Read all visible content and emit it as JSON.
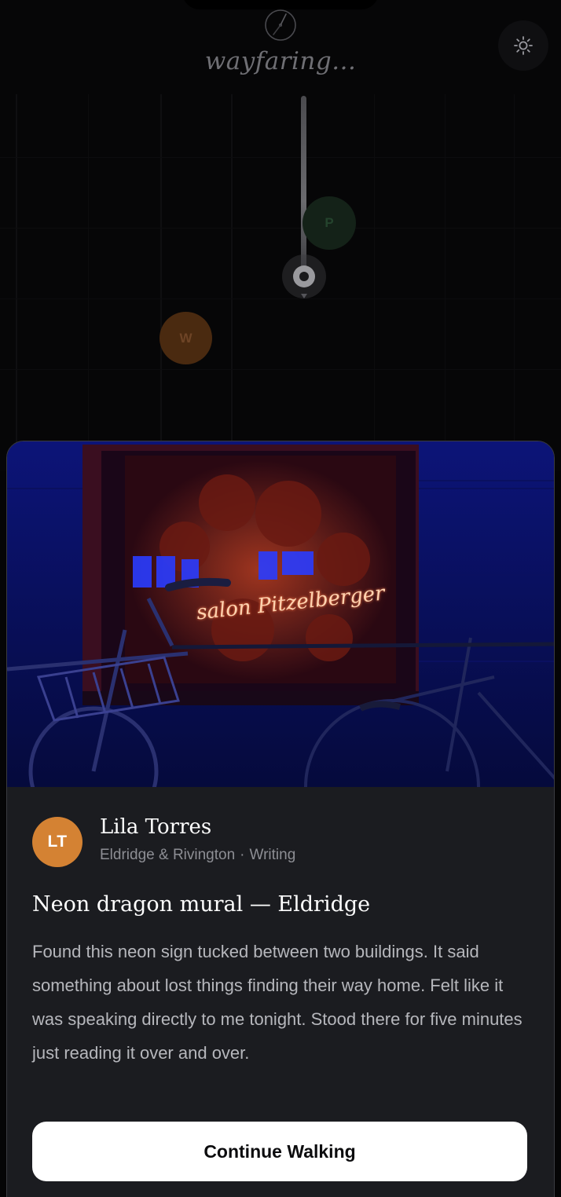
{
  "header": {
    "brand": "wayfaring...",
    "compass_icon": "compass-icon",
    "theme_icon": "sun-icon"
  },
  "map": {
    "markers": [
      {
        "initial": "P",
        "color": "#142218"
      },
      {
        "initial": "W",
        "color": "#4a2a10"
      }
    ],
    "user_location_icon": "location-dot-icon"
  },
  "post": {
    "photo_icon": "neon-sign-photo",
    "neon_text": "salon Pitzelberger",
    "avatar_initials": "LT",
    "author": "Lila Torres",
    "location": "Eldridge & Rivington",
    "separator": "·",
    "category": "Writing",
    "title": "Neon dragon mural — Eldridge",
    "body": "Found this neon sign tucked between two buildings. It said something about lost things finding their way home. Felt like it was speaking directly to me tonight. Stood there for five minutes just reading it over and over.",
    "action_label": "Continue Walking"
  },
  "colors": {
    "avatar": "#d48233",
    "sheet_bg": "#1b1c20",
    "button_bg": "#ffffff"
  }
}
